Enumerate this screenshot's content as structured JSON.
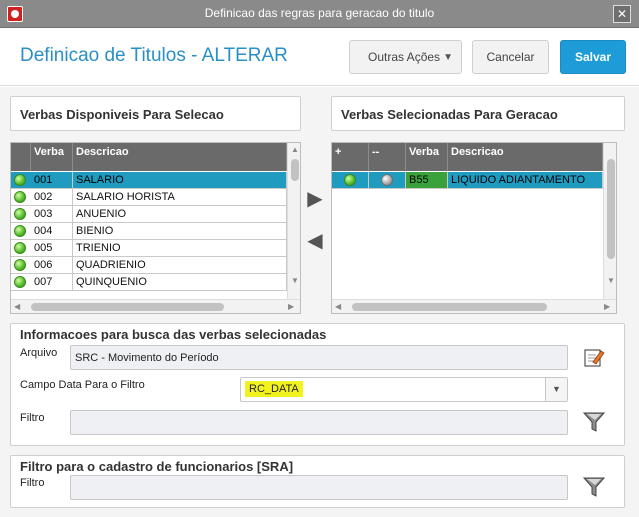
{
  "window": {
    "title": "Definicao das regras para geracao do titulo",
    "close_label": "✕"
  },
  "header": {
    "title": "Definicao de Titulos - ALTERAR",
    "more_actions": "Outras Ações",
    "cancel": "Cancelar",
    "save": "Salvar"
  },
  "left_panel": {
    "title": "Verbas Disponiveis Para Selecao",
    "columns": [
      "Verba",
      "Descricao"
    ],
    "rows": [
      {
        "verba": "001",
        "descricao": "SALARIO"
      },
      {
        "verba": "002",
        "descricao": "SALARIO HORISTA"
      },
      {
        "verba": "003",
        "descricao": "ANUENIO"
      },
      {
        "verba": "004",
        "descricao": "BIENIO"
      },
      {
        "verba": "005",
        "descricao": "TRIENIO"
      },
      {
        "verba": "006",
        "descricao": "QUADRIENIO"
      },
      {
        "verba": "007",
        "descricao": "QUINQUENIO"
      }
    ]
  },
  "right_panel": {
    "title": "Verbas Selecionadas Para Geracao",
    "columns": [
      "+",
      "--",
      "Verba",
      "Descricao"
    ],
    "rows": [
      {
        "verba": "B55",
        "descricao": "LIQUIDO ADIANTAMENTO"
      }
    ]
  },
  "info_section": {
    "title": "Informacoes para busca das verbas selecionadas",
    "arquivo_label": "Arquivo",
    "arquivo_value": "SRC - Movimento do Período",
    "campo_data_label": "Campo Data Para o Filtro",
    "campo_data_value": "RC_DATA",
    "filtro_label": "Filtro",
    "filtro_value": ""
  },
  "sra_section": {
    "title": "Filtro para o cadastro de funcionarios [SRA]",
    "filtro_label": "Filtro",
    "filtro_value": ""
  },
  "colors": {
    "accent": "#2a8fc4",
    "save": "#1d9cd8",
    "selected_row": "#1e9bbf",
    "highlight": "#f2f21e"
  }
}
